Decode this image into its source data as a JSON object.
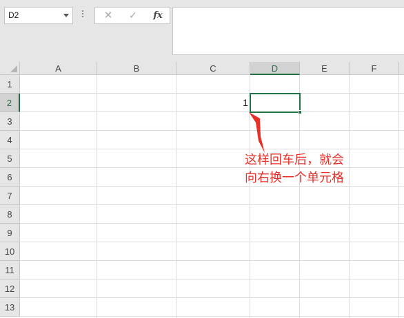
{
  "name_box": {
    "value": "D2"
  },
  "formula_bar": {
    "cancel_symbol": "✕",
    "enter_symbol": "✓",
    "fx_label": "fx",
    "value": ""
  },
  "sheet": {
    "columns": [
      "A",
      "B",
      "C",
      "D",
      "E",
      "F"
    ],
    "rows": [
      "1",
      "2",
      "3",
      "4",
      "5",
      "6",
      "7",
      "8",
      "9",
      "10",
      "11",
      "12",
      "13"
    ],
    "active_cell": "D2",
    "cells": {
      "C2": "1"
    }
  },
  "annotation": {
    "line1": "这样回车后，就会",
    "line2": "向右换一个单元格"
  },
  "colors": {
    "accent": "#217346",
    "annotation": "#e8302a"
  }
}
